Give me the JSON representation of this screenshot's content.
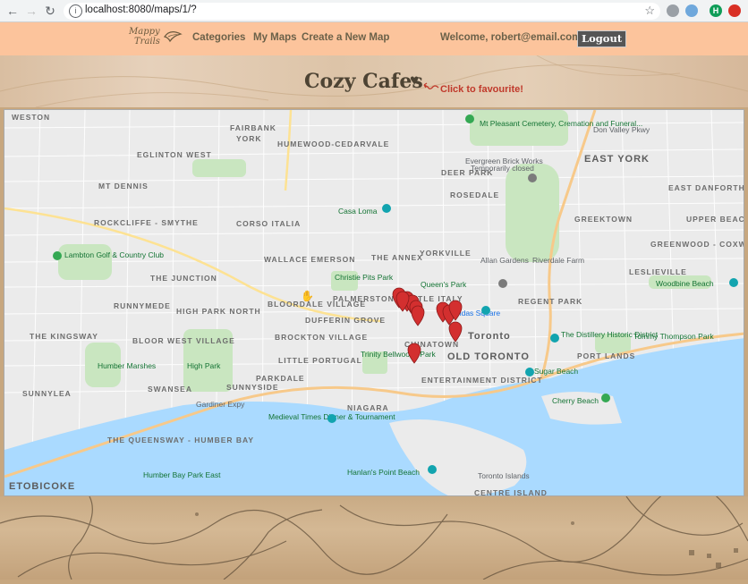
{
  "browser": {
    "url": "localhost:8080/maps/1/?",
    "profile_initial": "H"
  },
  "header": {
    "logo_text_line1": "Mappy",
    "logo_text_line2": "Trails",
    "nav": [
      "Categories",
      "My Maps",
      "Create a New Map"
    ],
    "welcome": "Welcome, robert@email.com!",
    "logout": "Logout"
  },
  "map_page": {
    "title": "Cozy Cafes",
    "favourite_hint": "Click to favourite!"
  },
  "map": {
    "neighbourhoods": [
      "WESTON",
      "YORK",
      "FAIRBANK",
      "HUMEWOOD-CEDARVALE",
      "EGLINTON WEST",
      "MT DENNIS",
      "ROCKCLIFFE - SMYTHE",
      "CORSO ITALIA",
      "DEER PARK",
      "ROSEDALE",
      "EAST YORK",
      "EAST DANFORTH",
      "GREEKTOWN",
      "UPPER BEACHES",
      "GREENWOOD - COXWELL",
      "LESLIEVILLE",
      "THE JUNCTION",
      "WALLACE EMERSON",
      "THE ANNEX",
      "YORKVILLE",
      "RUNNYMEDE",
      "HIGH PARK NORTH",
      "BLOORDALE VILLAGE",
      "PALMERSTON - LITTLE ITALY",
      "DUFFERIN GROVE",
      "REGENT PARK",
      "THE KINGSWAY",
      "BLOOR WEST VILLAGE",
      "BROCKTON VILLAGE",
      "LITTLE PORTUGAL",
      "CHINATOWN",
      "OLD TORONTO",
      "PORT LANDS",
      "SWANSEA",
      "SUNNYSIDE",
      "PARKDALE",
      "ENTERTAINMENT DISTRICT",
      "SUNNYLEA",
      "NIAGARA",
      "THE QUEENSWAY - HUMBER BAY",
      "ETOBICOKE"
    ],
    "places": [
      "Mt Pleasant Cemetery, Cremation and Funeral...",
      "Evergreen Brick Works",
      "Temporarily closed",
      "Casa Loma",
      "Lambton Golf & Country Club",
      "Christie Pits Park",
      "Queen's Park",
      "Allan Gardens",
      "Riverdale Farm",
      "Woodbine Beach",
      "The Distillery Historic District",
      "Tommy Thompson Park",
      "Sugar Beach",
      "Cherry Beach",
      "High Park",
      "Humber Marshes",
      "Trinity Bellwoods Park",
      "Medieval Times Dinner & Tournament",
      "Humber Bay Park East",
      "Hanlan's Point Beach",
      "Toronto Islands",
      "CENTRE ISLAND",
      "Dundas Square",
      "Toronto",
      "Gardiner Expy",
      "Don Valley Pkwy"
    ],
    "marker_count": 11
  }
}
